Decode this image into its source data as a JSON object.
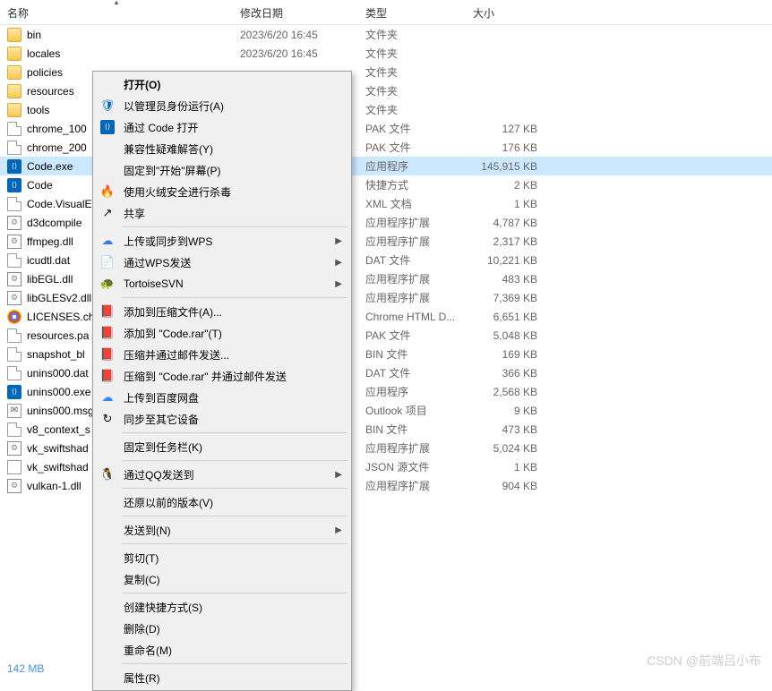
{
  "header": {
    "name": "名称",
    "date": "修改日期",
    "type": "类型",
    "size": "大小"
  },
  "files": [
    {
      "name": "bin",
      "date": "2023/6/20 16:45",
      "type": "文件夹",
      "size": "",
      "icon": "folder"
    },
    {
      "name": "locales",
      "date": "2023/6/20 16:45",
      "type": "文件夹",
      "size": "",
      "icon": "folder"
    },
    {
      "name": "policies",
      "date": "",
      "type": "文件夹",
      "size": "",
      "icon": "folder"
    },
    {
      "name": "resources",
      "date": "",
      "type": "文件夹",
      "size": "",
      "icon": "folder"
    },
    {
      "name": "tools",
      "date": "",
      "type": "文件夹",
      "size": "",
      "icon": "folder"
    },
    {
      "name": "chrome_100",
      "date": "",
      "type": "PAK 文件",
      "size": "127 KB",
      "icon": "file"
    },
    {
      "name": "chrome_200",
      "date": "",
      "type": "PAK 文件",
      "size": "176 KB",
      "icon": "file"
    },
    {
      "name": "Code.exe",
      "date": "",
      "type": "应用程序",
      "size": "145,915 KB",
      "icon": "vscode",
      "selected": true
    },
    {
      "name": "Code",
      "date": "",
      "type": "快捷方式",
      "size": "2 KB",
      "icon": "vscode"
    },
    {
      "name": "Code.VisualE",
      "date": "",
      "type": "XML 文档",
      "size": "1 KB",
      "icon": "file"
    },
    {
      "name": "d3dcompile",
      "date": "",
      "type": "应用程序扩展",
      "size": "4,787 KB",
      "icon": "dll"
    },
    {
      "name": "ffmpeg.dll",
      "date": "",
      "type": "应用程序扩展",
      "size": "2,317 KB",
      "icon": "dll"
    },
    {
      "name": "icudtl.dat",
      "date": "",
      "type": "DAT 文件",
      "size": "10,221 KB",
      "icon": "file"
    },
    {
      "name": "libEGL.dll",
      "date": "",
      "type": "应用程序扩展",
      "size": "483 KB",
      "icon": "dll"
    },
    {
      "name": "libGLESv2.dll",
      "date": "",
      "type": "应用程序扩展",
      "size": "7,369 KB",
      "icon": "dll"
    },
    {
      "name": "LICENSES.ch",
      "date": "",
      "type": "Chrome HTML D...",
      "size": "6,651 KB",
      "icon": "chrome"
    },
    {
      "name": "resources.pa",
      "date": "",
      "type": "PAK 文件",
      "size": "5,048 KB",
      "icon": "file"
    },
    {
      "name": "snapshot_bl",
      "date": "",
      "type": "BIN 文件",
      "size": "169 KB",
      "icon": "file"
    },
    {
      "name": "unins000.dat",
      "date": "",
      "type": "DAT 文件",
      "size": "366 KB",
      "icon": "file"
    },
    {
      "name": "unins000.exe",
      "date": "",
      "type": "应用程序",
      "size": "2,568 KB",
      "icon": "vscode"
    },
    {
      "name": "unins000.msg",
      "date": "",
      "type": "Outlook 项目",
      "size": "9 KB",
      "icon": "msg"
    },
    {
      "name": "v8_context_s",
      "date": "",
      "type": "BIN 文件",
      "size": "473 KB",
      "icon": "file"
    },
    {
      "name": "vk_swiftshad",
      "date": "",
      "type": "应用程序扩展",
      "size": "5,024 KB",
      "icon": "dll"
    },
    {
      "name": "vk_swiftshad",
      "date": "",
      "type": "JSON 源文件",
      "size": "1 KB",
      "icon": "json"
    },
    {
      "name": "vulkan-1.dll",
      "date": "",
      "type": "应用程序扩展",
      "size": "904 KB",
      "icon": "dll"
    }
  ],
  "menu": {
    "open": "打开(O)",
    "run_as_admin": "以管理员身份运行(A)",
    "open_with_code": "通过 Code 打开",
    "compat_troubleshoot": "兼容性疑难解答(Y)",
    "pin_start": "固定到\"开始\"屏幕(P)",
    "huorong_scan": "使用火绒安全进行杀毒",
    "share": "共享",
    "wps_upload": "上传或同步到WPS",
    "wps_send": "通过WPS发送",
    "tortoise_svn": "TortoiseSVN",
    "add_to_archive": "添加到压缩文件(A)...",
    "add_to_rar": "添加到 \"Code.rar\"(T)",
    "compress_email": "压缩并通过邮件发送...",
    "compress_rar_email": "压缩到 \"Code.rar\" 并通过邮件发送",
    "baidu_upload": "上传到百度网盘",
    "sync_devices": "同步至其它设备",
    "pin_taskbar": "固定到任务栏(K)",
    "qq_send": "通过QQ发送到",
    "restore_versions": "还原以前的版本(V)",
    "send_to": "发送到(N)",
    "cut": "剪切(T)",
    "copy": "复制(C)",
    "create_shortcut": "创建快捷方式(S)",
    "delete": "删除(D)",
    "rename": "重命名(M)",
    "properties": "属性(R)"
  },
  "icons": {
    "shield": "🛡",
    "vscode": "⟨⟩",
    "huorong": "🔥",
    "share": "↗",
    "cloud": "☁",
    "wps": "📄",
    "svn": "🐢",
    "rar": "📕",
    "baidu": "☁",
    "sync": "↻",
    "qq": "🐧"
  },
  "status": "142 MB",
  "watermark": "CSDN @前端吕小布"
}
